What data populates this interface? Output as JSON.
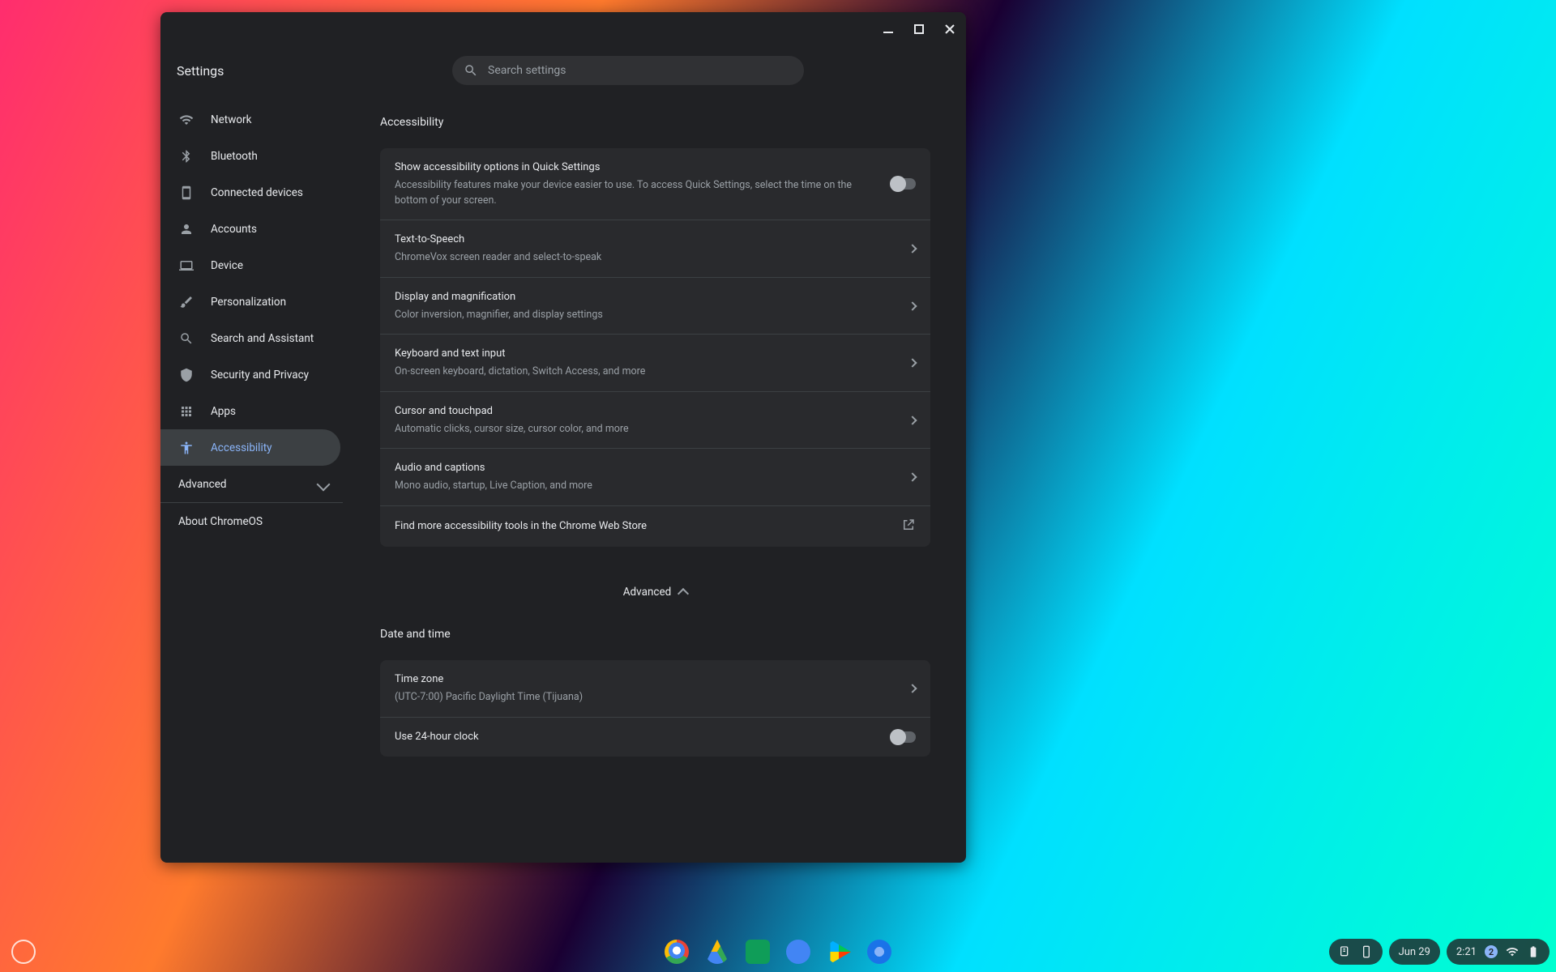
{
  "window": {
    "app_title": "Settings",
    "search_placeholder": "Search settings"
  },
  "sidebar": {
    "items": [
      {
        "id": "network",
        "label": "Network"
      },
      {
        "id": "bluetooth",
        "label": "Bluetooth"
      },
      {
        "id": "connected",
        "label": "Connected devices"
      },
      {
        "id": "accounts",
        "label": "Accounts"
      },
      {
        "id": "device",
        "label": "Device"
      },
      {
        "id": "personalization",
        "label": "Personalization"
      },
      {
        "id": "search",
        "label": "Search and Assistant"
      },
      {
        "id": "security",
        "label": "Security and Privacy"
      },
      {
        "id": "apps",
        "label": "Apps"
      },
      {
        "id": "accessibility",
        "label": "Accessibility"
      }
    ],
    "advanced_label": "Advanced",
    "about_label": "About ChromeOS"
  },
  "main": {
    "section1_title": "Accessibility",
    "row_show": {
      "title": "Show accessibility options in Quick Settings",
      "desc": "Accessibility features make your device easier to use. To access Quick Settings, select the time on the bottom of your screen."
    },
    "row_tts": {
      "title": "Text-to-Speech",
      "desc": "ChromeVox screen reader and select-to-speak"
    },
    "row_display": {
      "title": "Display and magnification",
      "desc": "Color inversion, magnifier, and display settings"
    },
    "row_keyboard": {
      "title": "Keyboard and text input",
      "desc": "On-screen keyboard, dictation, Switch Access, and more"
    },
    "row_cursor": {
      "title": "Cursor and touchpad",
      "desc": "Automatic clicks, cursor size, cursor color, and more"
    },
    "row_audio": {
      "title": "Audio and captions",
      "desc": "Mono audio, startup, Live Caption, and more"
    },
    "row_store": {
      "title": "Find more accessibility tools in the Chrome Web Store"
    },
    "advanced_label": "Advanced",
    "section2_title": "Date and time",
    "row_tz": {
      "title": "Time zone",
      "desc": "(UTC-7:00) Pacific Daylight Time (Tijuana)"
    },
    "row_24h": {
      "title": "Use 24-hour clock"
    }
  },
  "shelf": {
    "date": "Jun 29",
    "time": "2:21",
    "notif_count": "2"
  }
}
